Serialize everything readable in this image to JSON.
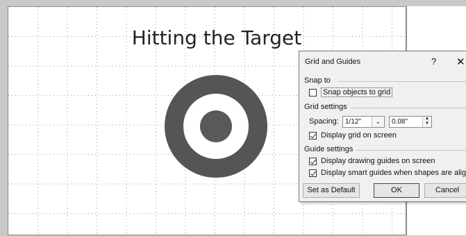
{
  "slide": {
    "title": "Hitting the Target"
  },
  "colors": {
    "ring_dark": "#555555",
    "ring_light": "#ffffff",
    "bullseye": "#595959",
    "grid_dot": "#9a9a9a"
  },
  "dialog": {
    "title": "Grid and Guides",
    "help_glyph": "?",
    "close_glyph": "✕",
    "snap_to": {
      "heading": "Snap to",
      "snap_objects_label": "Snap objects to grid",
      "snap_objects_checked": false
    },
    "grid_settings": {
      "heading": "Grid settings",
      "spacing_label": "Spacing:",
      "spacing_value": "1/12\"",
      "spacing_measure": "0.08\"",
      "display_grid_label": "Display grid on screen",
      "display_grid_checked": true
    },
    "guide_settings": {
      "heading": "Guide settings",
      "drawing_guides_label": "Display drawing guides on screen",
      "drawing_guides_checked": true,
      "smart_guides_label": "Display smart guides when shapes are aligned",
      "smart_guides_checked": true
    },
    "buttons": {
      "set_default": "Set as Default",
      "ok": "OK",
      "cancel": "Cancel"
    }
  }
}
